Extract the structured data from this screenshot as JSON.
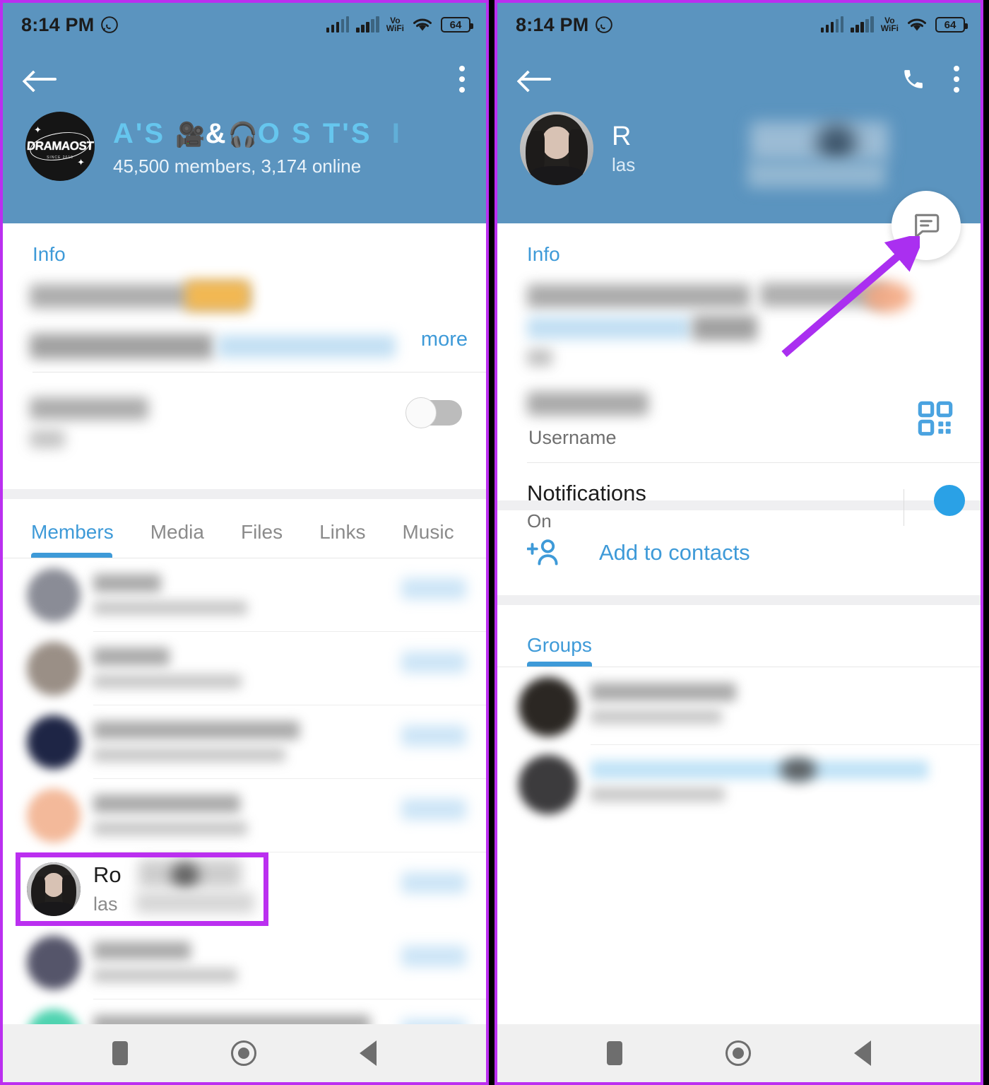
{
  "status_bar": {
    "time": "8:14 PM",
    "messaging_icon": "whatsapp-icon",
    "vo_line1": "Vo",
    "vo_line2": "WiFi",
    "battery_level": "64"
  },
  "left_panel": {
    "header": {
      "back_icon": "back-arrow-icon",
      "overflow_icon": "more-vertical-icon",
      "avatar_logo_text": "DRAMAOST",
      "avatar_logo_sub": "SINCE 2019",
      "group_title_parts": [
        "A",
        "'",
        "S",
        "🎥",
        "&",
        "🎧",
        "O",
        "S",
        "T",
        "'",
        "S"
      ],
      "group_title_plain": "A'S 🎥 & 🎧 O S T'S",
      "members_line": "45,500 members, 3,174 online"
    },
    "info": {
      "section_label": "Info",
      "more_label": "more",
      "notifications_value": "On",
      "toggle_state": "off"
    },
    "tabs": [
      {
        "label": "Members",
        "active": true
      },
      {
        "label": "Media",
        "active": false
      },
      {
        "label": "Files",
        "active": false
      },
      {
        "label": "Links",
        "active": false
      },
      {
        "label": "Music",
        "active": false
      }
    ],
    "members": [
      {
        "avatar_color": "#8a8c96",
        "name_width": 96,
        "sub_width": 218,
        "redacted": true
      },
      {
        "avatar_color": "#9a8f86",
        "name_width": 108,
        "sub_width": 210,
        "redacted": true
      },
      {
        "avatar_color": "#1e2545",
        "name_width": 292,
        "sub_width": 272,
        "redacted": true
      },
      {
        "avatar_color": "#f3b99a",
        "name_width": 208,
        "sub_width": 218,
        "redacted": true
      },
      {
        "avatar_color": "#3a3a44",
        "name_visible": "Ro",
        "sub_visible": "las",
        "highlighted": true
      },
      {
        "avatar_color": "#55556a",
        "name_width": 138,
        "sub_width": 204,
        "redacted": true
      },
      {
        "avatar_color": "#4fd3b0",
        "name_width": 392,
        "sub_width": 268,
        "redacted": true
      }
    ]
  },
  "right_panel": {
    "header": {
      "back_icon": "back-arrow-icon",
      "call_icon": "phone-icon",
      "overflow_icon": "more-vertical-icon",
      "person_name_visible": "R",
      "person_status_visible": "las",
      "fab_icon": "message-bubble-icon"
    },
    "info": {
      "section_label": "Info",
      "username_label": "Username",
      "qr_icon": "qr-code-icon",
      "notifications_label": "Notifications",
      "notifications_value": "On",
      "toggle_state": "on"
    },
    "add_contact": {
      "icon": "add-person-icon",
      "label": "Add to contacts"
    },
    "groups": {
      "tab_label": "Groups",
      "rows": [
        {
          "avatar_color": "#2b2723",
          "name_width": 206,
          "sub_width": 186,
          "tint": "gray"
        },
        {
          "avatar_color": "#3c3b3d",
          "name_width": 478,
          "sub_width": 190,
          "tint": "blue"
        }
      ]
    }
  },
  "nav_bar": {
    "recents_icon": "square-recents-icon",
    "home_icon": "circle-home-icon",
    "back_icon": "triangle-back-icon"
  },
  "annotation": {
    "arrow_color": "#aa2ff0",
    "highlight_color": "#bb2ff0",
    "arrow_points_to": "message-fab-button"
  },
  "colors": {
    "header_blue": "#5b94bf",
    "accent_blue": "#3e9ad8",
    "title_cyan": "#66c6ee",
    "toggle_on": "#2aa1e6"
  }
}
